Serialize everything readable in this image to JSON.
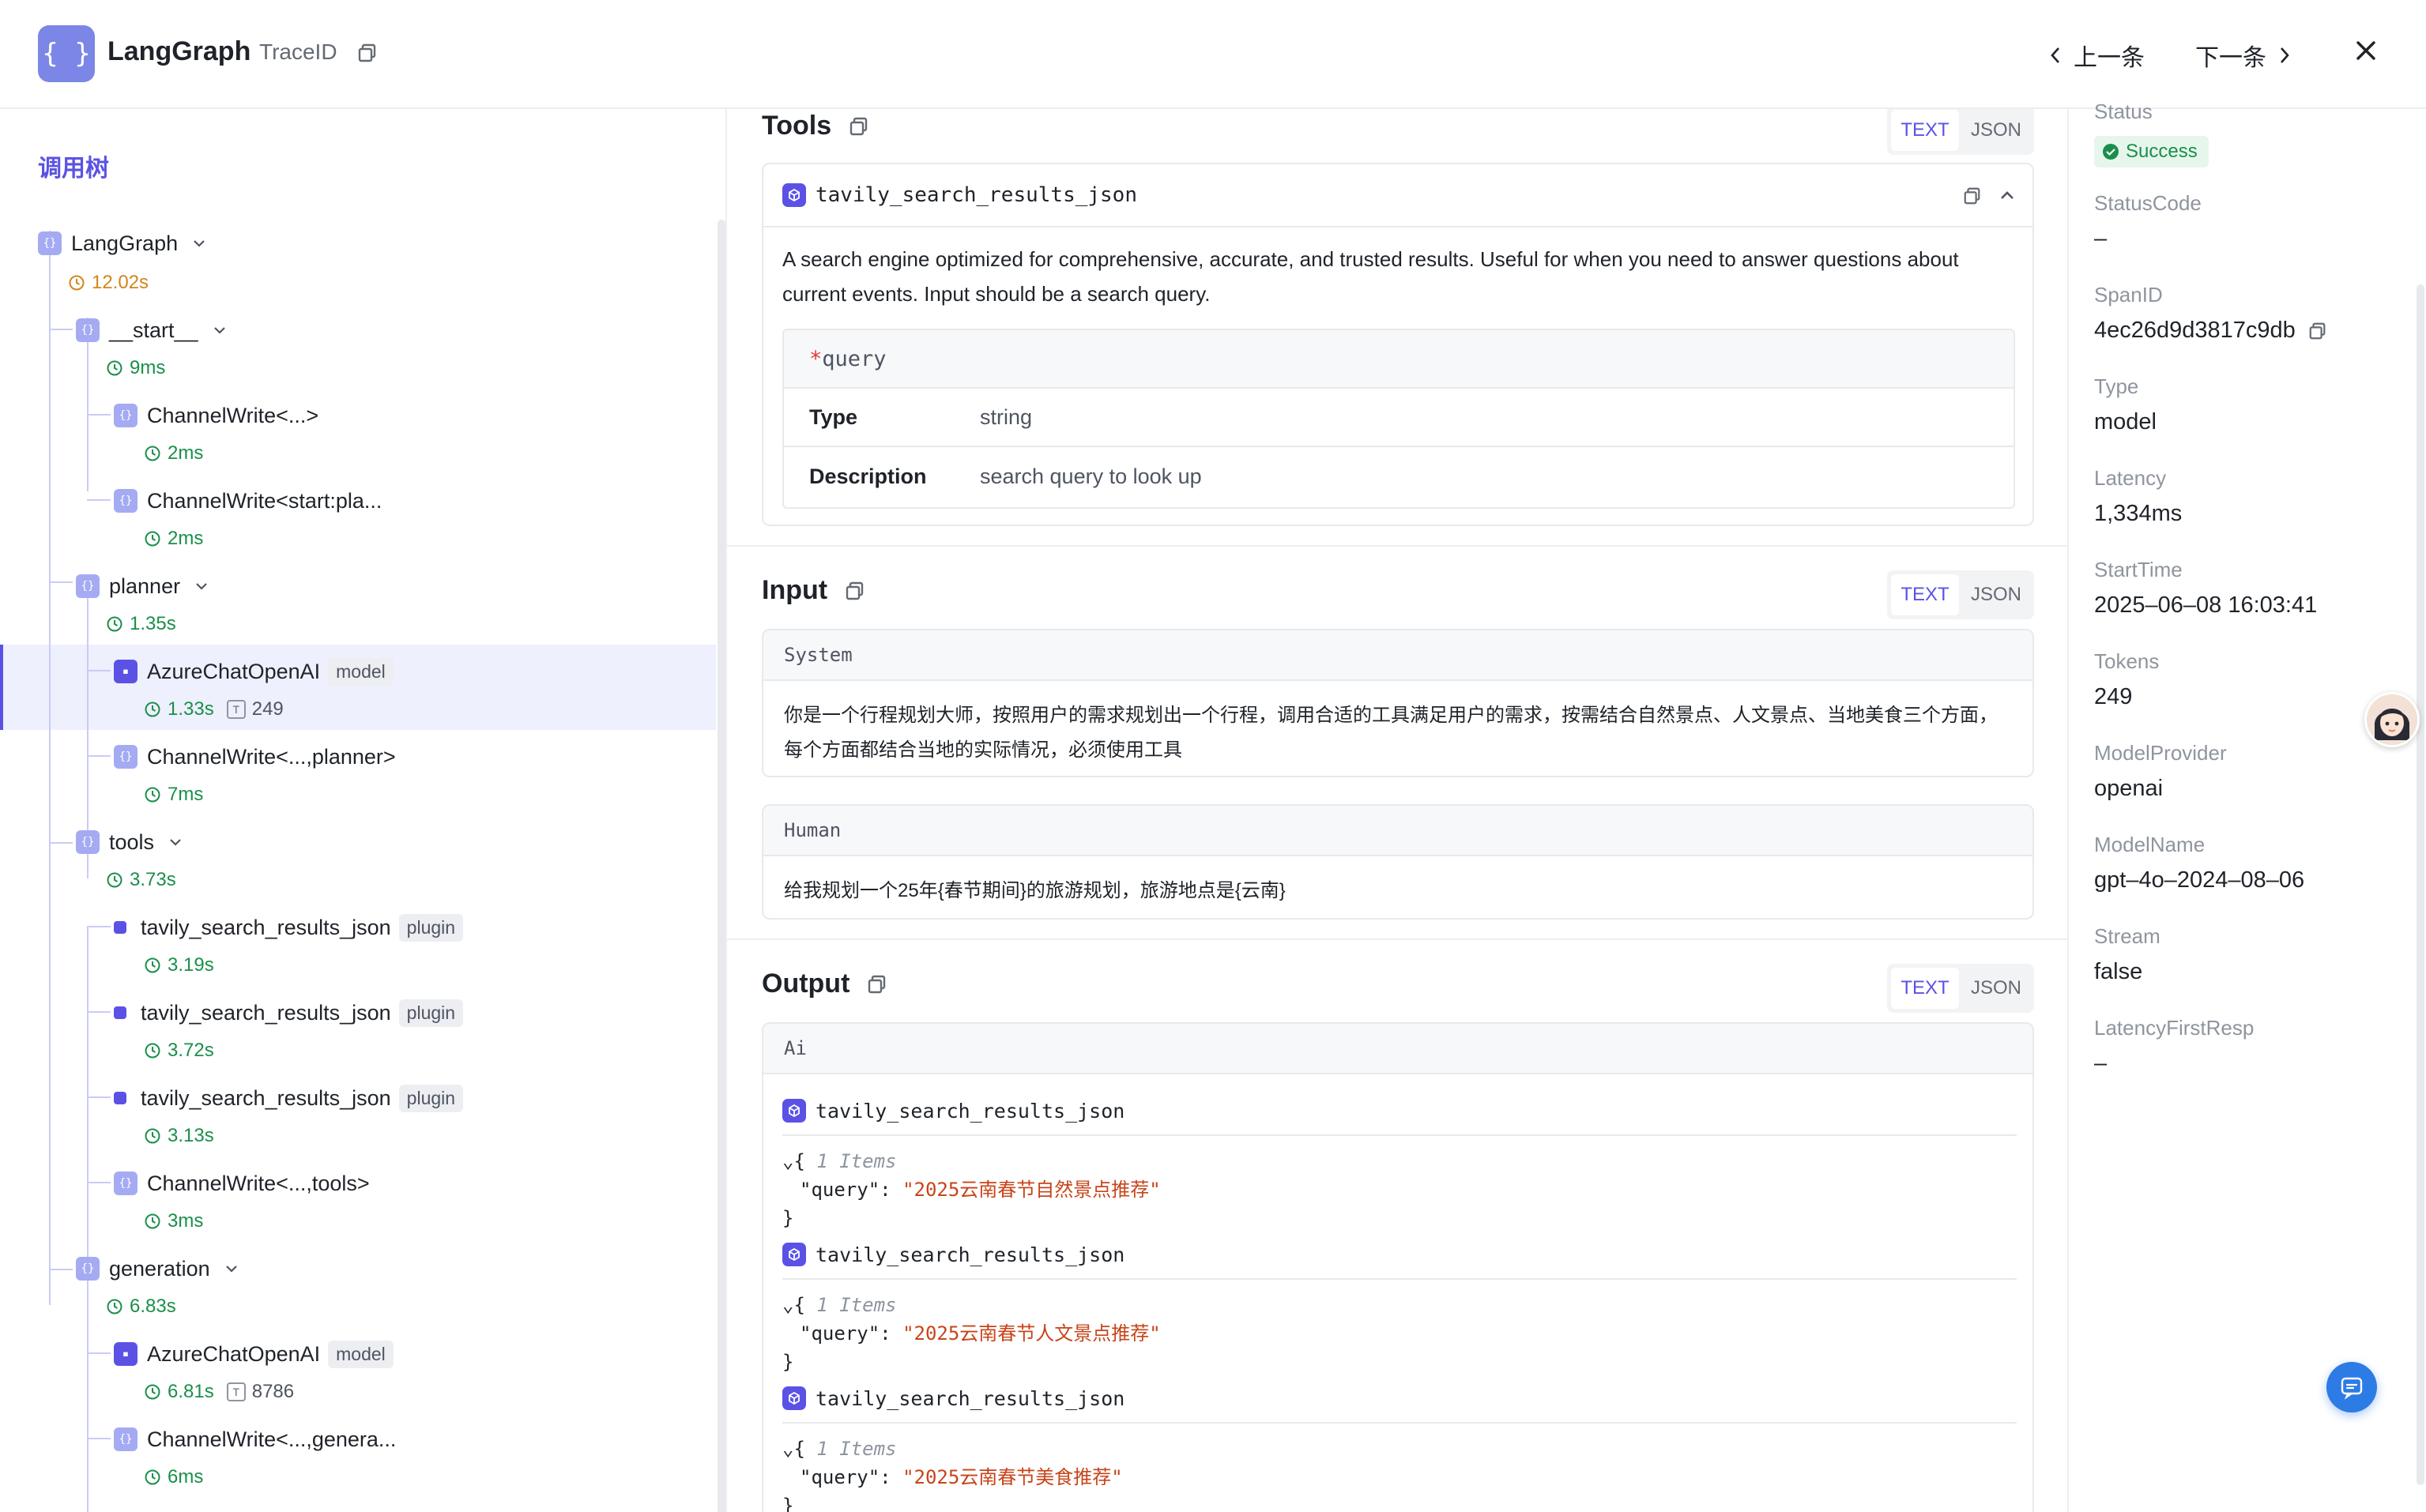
{
  "header": {
    "logo": "{ }",
    "title": "LangGraph",
    "trace_label": "TraceID",
    "prev_label": "上一条",
    "next_label": "下一条"
  },
  "tree": {
    "title": "调用树",
    "nodes": [
      {
        "name": "LangGraph",
        "time": "12.02s"
      },
      {
        "name": "__start__",
        "time": "9ms"
      },
      {
        "name": "ChannelWrite<...>",
        "time": "2ms"
      },
      {
        "name": "ChannelWrite<start:pla...",
        "time": "2ms"
      },
      {
        "name": "planner",
        "time": "1.35s"
      },
      {
        "name": "AzureChatOpenAI",
        "tag": "model",
        "time": "1.33s",
        "tokens": "249"
      },
      {
        "name": "ChannelWrite<...,planner>",
        "time": "7ms"
      },
      {
        "name": "tools",
        "time": "3.73s"
      },
      {
        "name": "tavily_search_results_json",
        "tag": "plugin",
        "time": "3.19s"
      },
      {
        "name": "tavily_search_results_json",
        "tag": "plugin",
        "time": "3.72s"
      },
      {
        "name": "tavily_search_results_json",
        "tag": "plugin",
        "time": "3.13s"
      },
      {
        "name": "ChannelWrite<...,tools>",
        "time": "3ms"
      },
      {
        "name": "generation",
        "time": "6.83s"
      },
      {
        "name": "AzureChatOpenAI",
        "tag": "model",
        "time": "6.81s",
        "tokens": "8786"
      },
      {
        "name": "ChannelWrite<...,genera...",
        "time": "6ms"
      }
    ]
  },
  "tools": {
    "title": "Tools",
    "seg_text": "TEXT",
    "seg_json": "JSON",
    "tool_name": "tavily_search_results_json",
    "description": "A search engine optimized for comprehensive, accurate, and trusted results. Useful for when you need to answer questions about current events. Input should be a search query.",
    "param_required": "*",
    "param_name": "query",
    "type_label": "Type",
    "type_value": "string",
    "desc_label": "Description",
    "desc_value": "search query to look up"
  },
  "input": {
    "title": "Input",
    "seg_text": "TEXT",
    "seg_json": "JSON",
    "system_label": "System",
    "system_text": "你是一个行程规划大师，按照用户的需求规划出一个行程，调用合适的工具满足用户的需求，按需结合自然景点、人文景点、当地美食三个方面，每个方面都结合当地的实际情况，必须使用工具",
    "human_label": "Human",
    "human_text": "给我规划一个25年{春节期间}的旅游规划，旅游地点是{云南}"
  },
  "output": {
    "title": "Output",
    "seg_text": "TEXT",
    "seg_json": "JSON",
    "ai_label": "Ai",
    "calls": [
      {
        "tool": "tavily_search_results_json",
        "brace_open": "{",
        "items": "1 Items",
        "key": "\"query\"",
        "colon": ":",
        "value": "\"2025云南春节自然景点推荐\"",
        "brace_close": "}"
      },
      {
        "tool": "tavily_search_results_json",
        "brace_open": "{",
        "items": "1 Items",
        "key": "\"query\"",
        "colon": ":",
        "value": "\"2025云南春节人文景点推荐\"",
        "brace_close": "}"
      },
      {
        "tool": "tavily_search_results_json",
        "brace_open": "{",
        "items": "1 Items",
        "key": "\"query\"",
        "colon": ":",
        "value": "\"2025云南春节美食推荐\"",
        "brace_close": "}"
      }
    ]
  },
  "props": {
    "status_label": "Status",
    "status_value": "Success",
    "statuscode_label": "StatusCode",
    "statuscode_value": "–",
    "spanid_label": "SpanID",
    "spanid_value": "4ec26d9d3817c9db",
    "type_label": "Type",
    "type_value": "model",
    "latency_label": "Latency",
    "latency_value": "1,334ms",
    "starttime_label": "StartTime",
    "starttime_value": "2025–06–08 16:03:41",
    "tokens_label": "Tokens",
    "tokens_value": "249",
    "provider_label": "ModelProvider",
    "provider_value": "openai",
    "modelname_label": "ModelName",
    "modelname_value": "gpt–4o–2024–08–06",
    "stream_label": "Stream",
    "stream_value": "false",
    "firstresp_label": "LatencyFirstResp",
    "firstresp_value": "–"
  },
  "colors": {
    "accent": "#5b52e5",
    "success": "#1a8f4a",
    "warning": "#d4851b",
    "json_value": "#c8441a"
  },
  "icons": [
    "braces-icon",
    "copy-icon",
    "chevron-left-icon",
    "chevron-right-icon",
    "close-icon",
    "chevron-down-icon",
    "clock-icon",
    "token-icon",
    "cube-icon",
    "chevron-up-icon",
    "check-circle-icon",
    "chat-icon"
  ]
}
